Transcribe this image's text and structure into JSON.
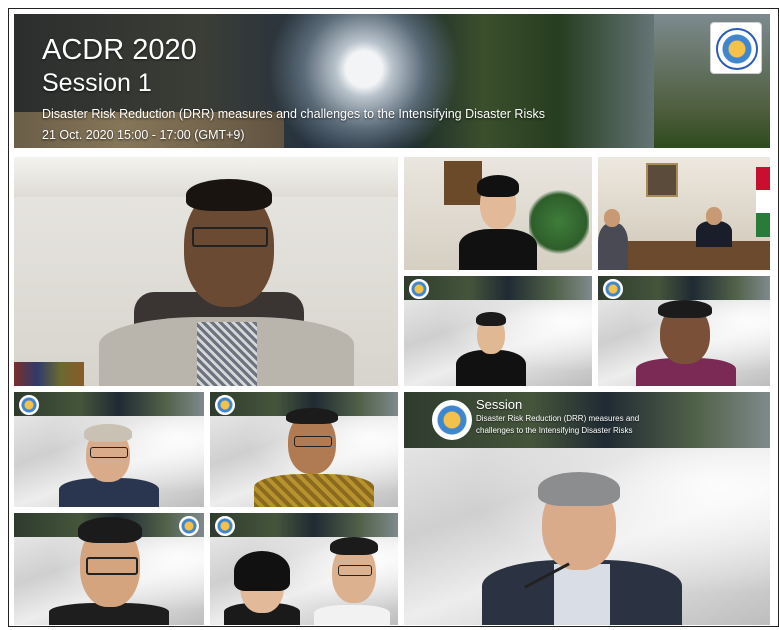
{
  "banner": {
    "title": "ACDR 2020",
    "session": "Session 1",
    "subtitle": "Disaster Risk Reduction (DRR) measures and   challenges to the Intensifying Disaster Risks",
    "date": "21 Oct. 2020 15:00 - 17:00 (GMT+9)",
    "logo_icon": "adrc-globe-logo-icon"
  },
  "spotlight_slide": {
    "session_label": "Session",
    "subtitle_line1": "Disaster Risk Reduction (DRR) measures and",
    "subtitle_line2": "challenges to the Intensifying Disaster Risks"
  },
  "tile_caption": "",
  "colors": {
    "banner_text": "#ffffff",
    "frame": "#222222",
    "logo_blue": "#2b5bb3",
    "logo_gold": "#f4c14a"
  }
}
